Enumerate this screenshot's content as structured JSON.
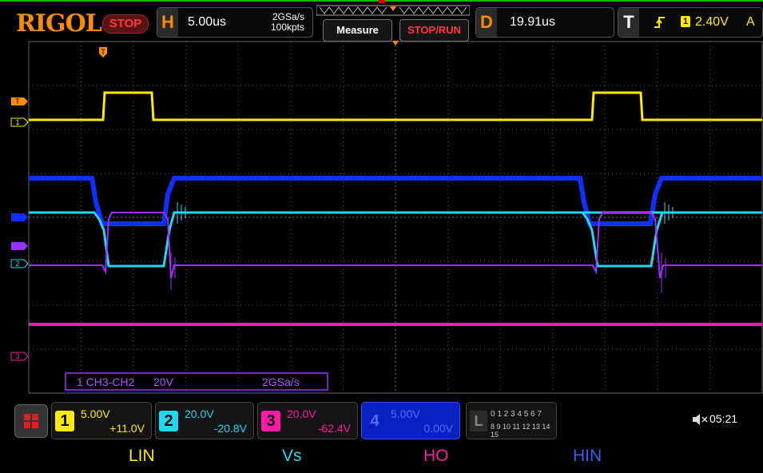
{
  "brand": "RIGOL",
  "run_state": "STOP",
  "horizontal": {
    "letter": "H",
    "timebase": "5.00us",
    "sample_rate": "2GSa/s",
    "memory_depth": "100kpts"
  },
  "buttons": {
    "measure": "Measure",
    "stop_run": "STOP/RUN"
  },
  "delay": {
    "letter": "D",
    "value": "19.91us"
  },
  "trigger": {
    "letter": "T",
    "level": "2.40V",
    "channel": "A",
    "source_num": "1"
  },
  "channels": [
    {
      "num": "1",
      "scale": "5.00V",
      "offset": "+11.0V",
      "color": "#ffea00"
    },
    {
      "num": "2",
      "scale": "20.0V",
      "offset": "-20.8V",
      "color": "#23d6f2"
    },
    {
      "num": "3",
      "scale": "20.0V",
      "offset": "-62.4V",
      "color": "#ff1aa8"
    },
    {
      "num": "4",
      "scale": "5.00V",
      "offset": "0.00V",
      "color": "#1030ff"
    }
  ],
  "math_info": {
    "source": "1 CH3-CH2",
    "scale": "20V",
    "rate": "2GSa/s"
  },
  "markers": {
    "trigger": "T",
    "ch1": "1",
    "ch2": "2",
    "ch3": "3"
  },
  "logic": {
    "row1": "0 1 2 3 4 5 6 7",
    "row2": "8 9 10 11 12 13 14 15",
    "letter": "L"
  },
  "status": {
    "time": "05:21"
  },
  "signal_labels": [
    {
      "text": "LIN",
      "color": "#ffea00"
    },
    {
      "text": "Vs",
      "color": "#23d6f2"
    },
    {
      "text": "HO",
      "color": "#ff1aa8"
    },
    {
      "text": "HIN",
      "color": "#3a5cff"
    }
  ]
}
